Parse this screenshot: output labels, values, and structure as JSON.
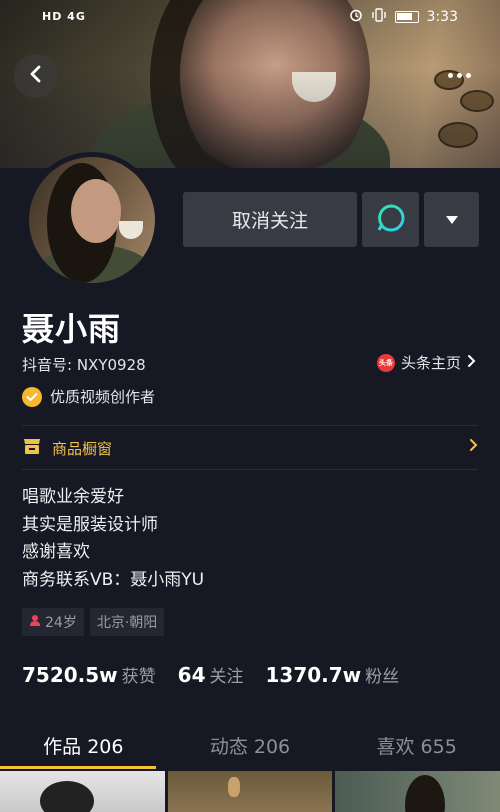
{
  "status_bar": {
    "network": "HD 4G",
    "time": "3:33"
  },
  "profile": {
    "name": "聂小雨",
    "douyin_id": "抖音号: NXY0928",
    "toutiao_label": "头条主页",
    "toutiao_logo_text": "头条",
    "certification": "优质视频创作者",
    "shop_label": "商品橱窗"
  },
  "actions": {
    "unfollow_label": "取消关注"
  },
  "bio": {
    "line1": "唱歌业余爱好",
    "line2": "其实是服装设计师",
    "line3": "感谢喜欢",
    "line4": "商务联系VB：聂小雨YU"
  },
  "tags": {
    "age": "24岁",
    "location": "北京·朝阳"
  },
  "stats": {
    "likes_value": "7520.5w",
    "likes_label": "获赞",
    "following_value": "64",
    "following_label": "关注",
    "followers_value": "1370.7w",
    "followers_label": "粉丝"
  },
  "tabs": {
    "works": "作品 206",
    "activity": "动态 206",
    "likes": "喜欢 655"
  },
  "colors": {
    "background": "#161823",
    "accent_yellow": "#f4c230",
    "button_bg": "#393b44"
  }
}
